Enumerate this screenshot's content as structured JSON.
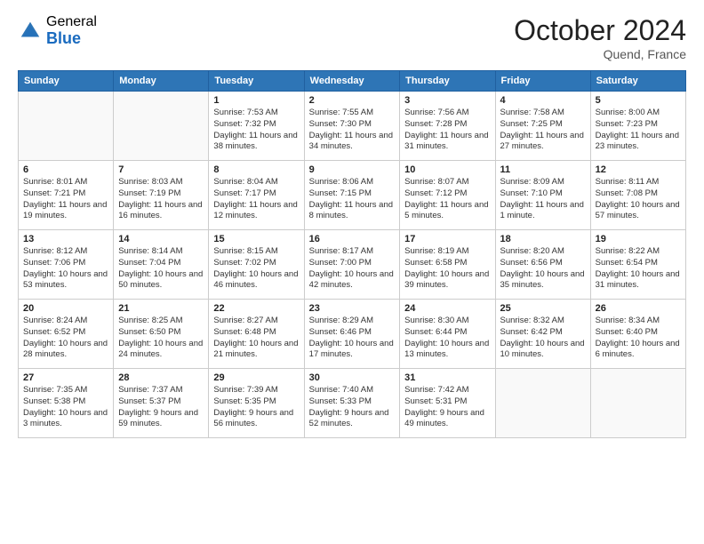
{
  "header": {
    "logo_general": "General",
    "logo_blue": "Blue",
    "month_title": "October 2024",
    "location": "Quend, France"
  },
  "days_of_week": [
    "Sunday",
    "Monday",
    "Tuesday",
    "Wednesday",
    "Thursday",
    "Friday",
    "Saturday"
  ],
  "weeks": [
    [
      {
        "day": "",
        "empty": true
      },
      {
        "day": "",
        "empty": true
      },
      {
        "day": "1",
        "sunrise": "7:53 AM",
        "sunset": "7:32 PM",
        "daylight": "11 hours and 38 minutes."
      },
      {
        "day": "2",
        "sunrise": "7:55 AM",
        "sunset": "7:30 PM",
        "daylight": "11 hours and 34 minutes."
      },
      {
        "day": "3",
        "sunrise": "7:56 AM",
        "sunset": "7:28 PM",
        "daylight": "11 hours and 31 minutes."
      },
      {
        "day": "4",
        "sunrise": "7:58 AM",
        "sunset": "7:25 PM",
        "daylight": "11 hours and 27 minutes."
      },
      {
        "day": "5",
        "sunrise": "8:00 AM",
        "sunset": "7:23 PM",
        "daylight": "11 hours and 23 minutes."
      }
    ],
    [
      {
        "day": "6",
        "sunrise": "8:01 AM",
        "sunset": "7:21 PM",
        "daylight": "11 hours and 19 minutes."
      },
      {
        "day": "7",
        "sunrise": "8:03 AM",
        "sunset": "7:19 PM",
        "daylight": "11 hours and 16 minutes."
      },
      {
        "day": "8",
        "sunrise": "8:04 AM",
        "sunset": "7:17 PM",
        "daylight": "11 hours and 12 minutes."
      },
      {
        "day": "9",
        "sunrise": "8:06 AM",
        "sunset": "7:15 PM",
        "daylight": "11 hours and 8 minutes."
      },
      {
        "day": "10",
        "sunrise": "8:07 AM",
        "sunset": "7:12 PM",
        "daylight": "11 hours and 5 minutes."
      },
      {
        "day": "11",
        "sunrise": "8:09 AM",
        "sunset": "7:10 PM",
        "daylight": "11 hours and 1 minute."
      },
      {
        "day": "12",
        "sunrise": "8:11 AM",
        "sunset": "7:08 PM",
        "daylight": "10 hours and 57 minutes."
      }
    ],
    [
      {
        "day": "13",
        "sunrise": "8:12 AM",
        "sunset": "7:06 PM",
        "daylight": "10 hours and 53 minutes."
      },
      {
        "day": "14",
        "sunrise": "8:14 AM",
        "sunset": "7:04 PM",
        "daylight": "10 hours and 50 minutes."
      },
      {
        "day": "15",
        "sunrise": "8:15 AM",
        "sunset": "7:02 PM",
        "daylight": "10 hours and 46 minutes."
      },
      {
        "day": "16",
        "sunrise": "8:17 AM",
        "sunset": "7:00 PM",
        "daylight": "10 hours and 42 minutes."
      },
      {
        "day": "17",
        "sunrise": "8:19 AM",
        "sunset": "6:58 PM",
        "daylight": "10 hours and 39 minutes."
      },
      {
        "day": "18",
        "sunrise": "8:20 AM",
        "sunset": "6:56 PM",
        "daylight": "10 hours and 35 minutes."
      },
      {
        "day": "19",
        "sunrise": "8:22 AM",
        "sunset": "6:54 PM",
        "daylight": "10 hours and 31 minutes."
      }
    ],
    [
      {
        "day": "20",
        "sunrise": "8:24 AM",
        "sunset": "6:52 PM",
        "daylight": "10 hours and 28 minutes."
      },
      {
        "day": "21",
        "sunrise": "8:25 AM",
        "sunset": "6:50 PM",
        "daylight": "10 hours and 24 minutes."
      },
      {
        "day": "22",
        "sunrise": "8:27 AM",
        "sunset": "6:48 PM",
        "daylight": "10 hours and 21 minutes."
      },
      {
        "day": "23",
        "sunrise": "8:29 AM",
        "sunset": "6:46 PM",
        "daylight": "10 hours and 17 minutes."
      },
      {
        "day": "24",
        "sunrise": "8:30 AM",
        "sunset": "6:44 PM",
        "daylight": "10 hours and 13 minutes."
      },
      {
        "day": "25",
        "sunrise": "8:32 AM",
        "sunset": "6:42 PM",
        "daylight": "10 hours and 10 minutes."
      },
      {
        "day": "26",
        "sunrise": "8:34 AM",
        "sunset": "6:40 PM",
        "daylight": "10 hours and 6 minutes."
      }
    ],
    [
      {
        "day": "27",
        "sunrise": "7:35 AM",
        "sunset": "5:38 PM",
        "daylight": "10 hours and 3 minutes."
      },
      {
        "day": "28",
        "sunrise": "7:37 AM",
        "sunset": "5:37 PM",
        "daylight": "9 hours and 59 minutes."
      },
      {
        "day": "29",
        "sunrise": "7:39 AM",
        "sunset": "5:35 PM",
        "daylight": "9 hours and 56 minutes."
      },
      {
        "day": "30",
        "sunrise": "7:40 AM",
        "sunset": "5:33 PM",
        "daylight": "9 hours and 52 minutes."
      },
      {
        "day": "31",
        "sunrise": "7:42 AM",
        "sunset": "5:31 PM",
        "daylight": "9 hours and 49 minutes."
      },
      {
        "day": "",
        "empty": true
      },
      {
        "day": "",
        "empty": true
      }
    ]
  ]
}
